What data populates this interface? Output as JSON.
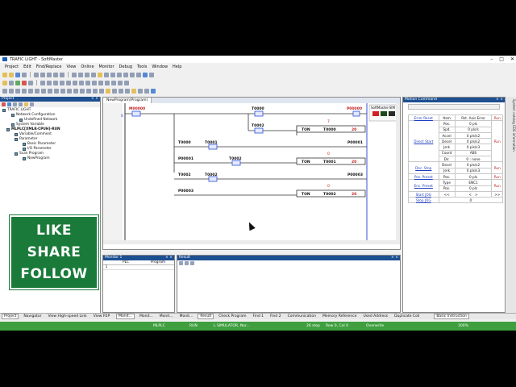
{
  "window": {
    "title": "TRAFIC LIGHT - SoftMaster"
  },
  "menu": [
    "Project",
    "Edit",
    "Find/Replace",
    "View",
    "Online",
    "Monitor",
    "Debug",
    "Tools",
    "Window",
    "Help"
  ],
  "project_panel": {
    "title": "Project",
    "tree": [
      {
        "label": "TRAFIC LIGHT",
        "level": 0,
        "bold": false
      },
      {
        "label": "Network Configuration",
        "level": 1
      },
      {
        "label": "Undefined Network",
        "level": 2
      },
      {
        "label": "System Variable",
        "level": 1
      },
      {
        "label": "MLPLC[XMLK-CPUH]-RUN",
        "level": 0,
        "bold": true
      },
      {
        "label": "Variable/Comment",
        "level": 1
      },
      {
        "label": "Parameter",
        "level": 1
      },
      {
        "label": "Basic Parameter",
        "level": 2
      },
      {
        "label": "I/O Parameter",
        "level": 2
      },
      {
        "label": "Scan Program",
        "level": 1
      },
      {
        "label": "NewProgram",
        "level": 2
      }
    ]
  },
  "overlay": {
    "like": "LIKE",
    "share": "SHARE",
    "follow": "FOLLOW"
  },
  "editor": {
    "tab_label": "NewProgram(Program)",
    "softmaster_sim": "SoftMaster-SIM",
    "contacts": {
      "M00000": "M00000",
      "T0000": "T0000",
      "P00000": "P00000",
      "T0002": "T0002",
      "T0001": "T0001",
      "P00001": "P00001",
      "P00002": "P00002",
      "P00003": "P00003"
    },
    "timers": [
      {
        "ton": "TON",
        "name": "T0000",
        "preset": "20",
        "num": "7"
      },
      {
        "ton": "TON",
        "name": "T0001",
        "preset": "20",
        "num": "0"
      },
      {
        "ton": "TON",
        "name": "T0002",
        "preset": "20",
        "num": "0"
      }
    ],
    "rung_number": "0"
  },
  "monitor": {
    "title": "Monitor 1",
    "col_plc": "PLC",
    "col_program": "Program",
    "row1": "1"
  },
  "result": {
    "title": "Result"
  },
  "motion": {
    "title": "Motion Command",
    "header": [
      "Item",
      "Rst. Axis Error",
      "Run"
    ],
    "error_reset": "Error Reset",
    "direct_start": "Direct Start",
    "rows": [
      {
        "item": "Pos.",
        "value": "0 pls"
      },
      {
        "item": "Spd.",
        "value": "0 pls/s"
      },
      {
        "item": "Accel",
        "value": "0 pls/s2"
      },
      {
        "item": "Decel",
        "value": "0 pls/s2"
      },
      {
        "item": "Jerk",
        "value": "0 pls/s3"
      },
      {
        "item": "Coord",
        "value": "ABS"
      },
      {
        "item": "Dir.",
        "value": "0 : none"
      }
    ],
    "dec_stop": "Dec. Stop",
    "dec_rows": [
      {
        "item": "Decel",
        "value": "0 pls/s2"
      },
      {
        "item": "Jerk",
        "value": "0 pls/s3"
      }
    ],
    "pos_preset": "Pos. Preset",
    "pos_row": {
      "item": "Pos.",
      "value": "0 pls"
    },
    "enc_preset": "Enc. Preset",
    "enc_rows": [
      {
        "item": "Type",
        "value": "ENC1"
      },
      {
        "item": "Pos.",
        "value": "0 pls"
      }
    ],
    "start_jog": "Start JOG",
    "stop_jog": "Stop JOG",
    "jog_buttons": [
      "<<",
      "<",
      ">",
      ">>"
    ],
    "jog_value": "0",
    "run": "Run"
  },
  "right_sidebar": "System catalog  EDS information",
  "left_bottom_tabs": [
    "Project",
    "Navigator",
    "View High-speed Link",
    "View P2P"
  ],
  "mid_bottom_tabs": [
    "Monit...",
    "Monit...",
    "Monit...",
    "Monit..."
  ],
  "result_tabs": [
    "Result",
    "Check Program",
    "Find 1",
    "Find 2",
    "Communication",
    "Memory Reference",
    "Used Address",
    "Duplicate Coil"
  ],
  "motion_bottom_tab": "Basic Instruction",
  "status": {
    "plc": "MLPLC",
    "mode": "RUN",
    "conn": "L SIMULATOR, Nor...",
    "steps": "26 step",
    "rowcol": "Row 0, Col 0",
    "overwrite": "Overwrite",
    "zoom": "100%"
  }
}
